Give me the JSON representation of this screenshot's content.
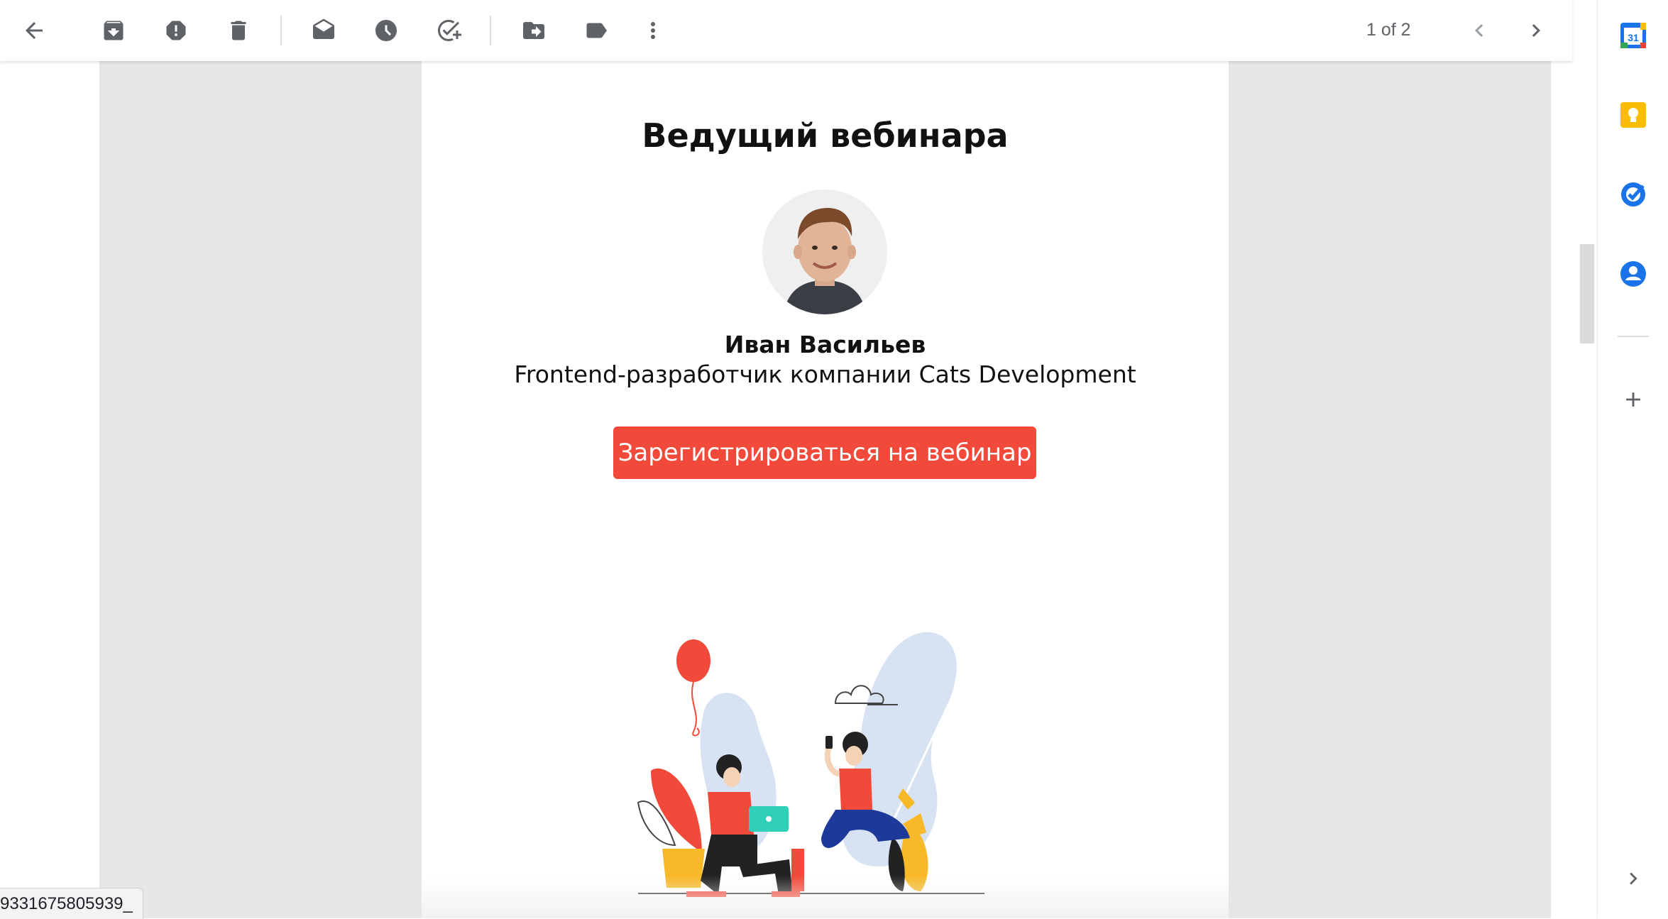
{
  "toolbar": {
    "icons": [
      "back-arrow-icon",
      "archive-icon",
      "report-spam-icon",
      "delete-icon",
      "mark-unread-icon",
      "snooze-icon",
      "add-task-icon",
      "move-to-icon",
      "label-icon",
      "more-vert-icon"
    ],
    "counter": "1 of 2"
  },
  "email": {
    "heading": "Ведущий вебинара",
    "host_name": "Иван Васильев",
    "host_role": "Frontend-разработчик компании Cats Development",
    "cta_label": "Зарегистрироваться на вебинар",
    "cta_color": "#f24a3a"
  },
  "status_bar": {
    "url": "9331675805939_"
  },
  "side_panel": {
    "calendar_day": "31",
    "apps": [
      "calendar-icon",
      "keep-icon",
      "tasks-icon",
      "contacts-icon"
    ],
    "colors": {
      "calendar": "#1a73e8",
      "keep": "#fbbc04",
      "tasks": "#1a73e8",
      "contacts": "#1a73e8"
    }
  }
}
